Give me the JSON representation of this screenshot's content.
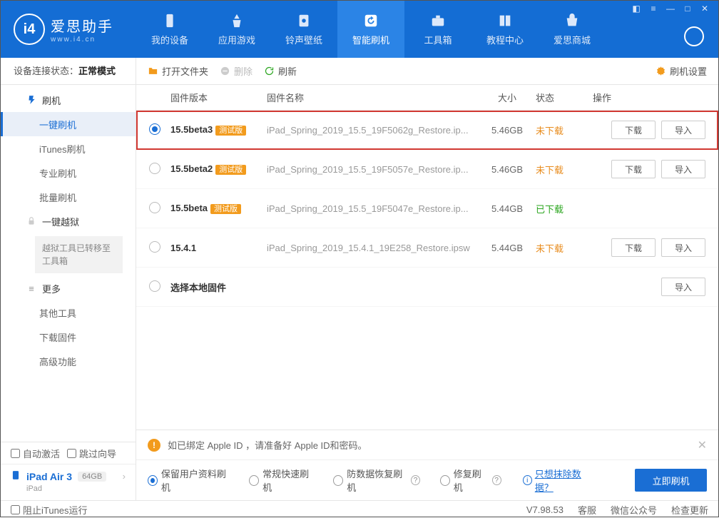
{
  "app": {
    "name": "爱思助手",
    "domain": "www.i4.cn"
  },
  "nav": [
    {
      "label": "我的设备"
    },
    {
      "label": "应用游戏"
    },
    {
      "label": "铃声壁纸"
    },
    {
      "label": "智能刷机"
    },
    {
      "label": "工具箱"
    },
    {
      "label": "教程中心"
    },
    {
      "label": "爱思商城"
    }
  ],
  "sidebar": {
    "conn_label": "设备连接状态：",
    "conn_status": "正常模式",
    "items": {
      "flash": "刷机",
      "oneclick": "一键刷机",
      "itunes": "iTunes刷机",
      "pro": "专业刷机",
      "batch": "批量刷机",
      "jailbreak": "一键越狱",
      "jailbreak_notice": "越狱工具已转移至工具箱",
      "more": "更多",
      "other": "其他工具",
      "dlfw": "下载固件",
      "adv": "高级功能"
    },
    "bottom": {
      "auto_activate": "自动激活",
      "skip_guide": "跳过向导"
    }
  },
  "device": {
    "name": "iPad Air 3",
    "storage": "64GB",
    "type": "iPad"
  },
  "toolbar": {
    "open": "打开文件夹",
    "delete": "删除",
    "refresh": "刷新",
    "settings": "刷机设置"
  },
  "th": {
    "version": "固件版本",
    "name": "固件名称",
    "size": "大小",
    "status": "状态",
    "action": "操作"
  },
  "rows": [
    {
      "v": "15.5beta3",
      "beta": "测试版",
      "n": "iPad_Spring_2019_15.5_19F5062g_Restore.ip...",
      "s": "5.46GB",
      "st": "未下载",
      "stc": "pending",
      "dl": true,
      "imp": true,
      "sel": true,
      "hi": true
    },
    {
      "v": "15.5beta2",
      "beta": "测试版",
      "n": "iPad_Spring_2019_15.5_19F5057e_Restore.ip...",
      "s": "5.46GB",
      "st": "未下载",
      "stc": "pending",
      "dl": true,
      "imp": true
    },
    {
      "v": "15.5beta",
      "beta": "测试版",
      "n": "iPad_Spring_2019_15.5_19F5047e_Restore.ip...",
      "s": "5.44GB",
      "st": "已下载",
      "stc": "done"
    },
    {
      "v": "15.4.1",
      "n": "iPad_Spring_2019_15.4.1_19E258_Restore.ipsw",
      "s": "5.44GB",
      "st": "未下载",
      "stc": "pending",
      "dl": true,
      "imp": true
    },
    {
      "v": "选择本地固件",
      "local": true,
      "imp": true
    }
  ],
  "buttons": {
    "download": "下载",
    "import": "导入"
  },
  "banner": "如已绑定 Apple ID ，请准备好 Apple ID和密码。",
  "modes": [
    {
      "label": "保留用户资料刷机",
      "sel": true
    },
    {
      "label": "常规快速刷机"
    },
    {
      "label": "防数据恢复刷机",
      "q": true
    },
    {
      "label": "修复刷机",
      "q": true
    }
  ],
  "erase_link": "只想抹除数据？",
  "primary": "立即刷机",
  "statusbar": {
    "block": "阻止iTunes运行",
    "ver": "V7.98.53",
    "cs": "客服",
    "wx": "微信公众号",
    "upd": "检查更新"
  }
}
